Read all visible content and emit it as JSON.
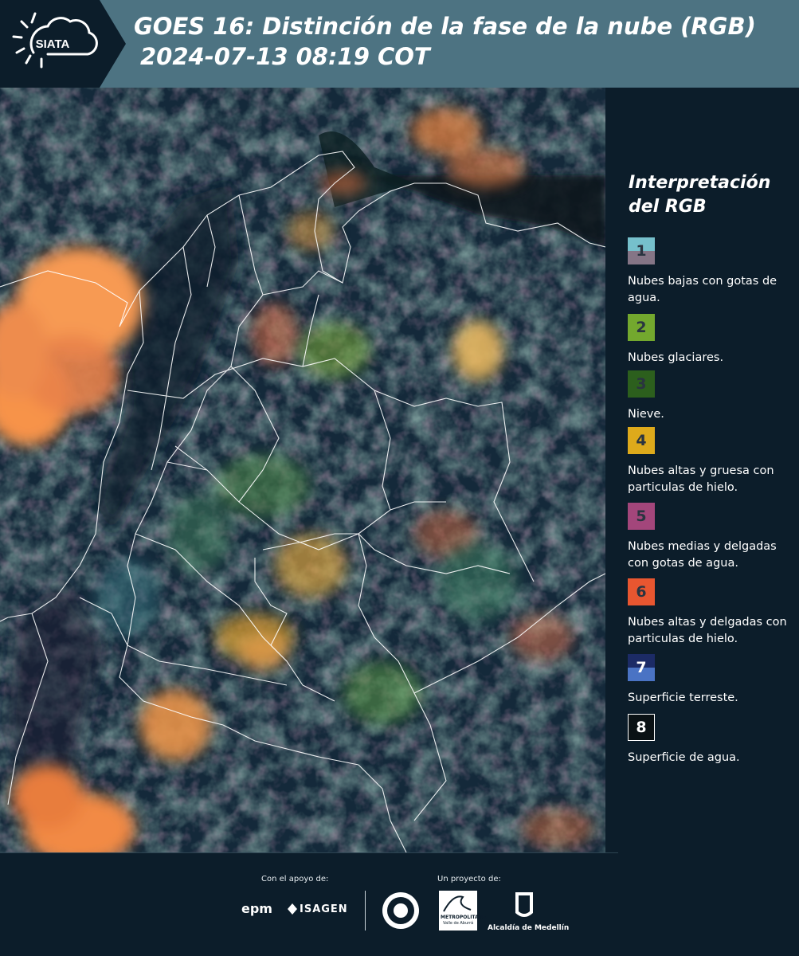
{
  "header": {
    "logo_text": "SIATA",
    "title_line1": "GOES 16: Distinción de la fase de la nube (RGB)",
    "title_line2": "2024-07-13 08:19 COT"
  },
  "legend": {
    "title": "Interpretación del RGB",
    "items": [
      {
        "num": "1",
        "label": "Nubes bajas con gotas de agua.",
        "color_top": "#76c0cc",
        "color_bottom": "#857586"
      },
      {
        "num": "2",
        "label": "Nubes glaciares.",
        "color_top": "#73a82e",
        "color_bottom": "#73a82e"
      },
      {
        "num": "3",
        "label": "Nieve.",
        "color_top": "#2c5f1d",
        "color_bottom": "#2c5f1d"
      },
      {
        "num": "4",
        "label": "Nubes altas y gruesa con particulas de hielo.",
        "color_top": "#deaa1b",
        "color_bottom": "#deaa1b"
      },
      {
        "num": "5",
        "label": "Nubes medias y delgadas con gotas de agua.",
        "color_top": "#a3467b",
        "color_bottom": "#a3467b"
      },
      {
        "num": "6",
        "label": "Nubes altas y delgadas con particulas de hielo.",
        "color_top": "#e85630",
        "color_bottom": "#e85630"
      },
      {
        "num": "7",
        "label": "Superficie terreste.",
        "color_top": "#1c2b66",
        "color_bottom": "#4a73c4"
      },
      {
        "num": "8",
        "label": "Superficie de agua.",
        "color_top": "#0a1114",
        "color_bottom": "#0a1114"
      }
    ]
  },
  "footer": {
    "support_label": "Con el apoyo de:",
    "project_label": "Un proyecto de:",
    "sponsor1": "epm",
    "sponsor2": "ISAGEN",
    "partner1": "METROPOLITANA",
    "partner1_sub": "Valle de Aburrá",
    "partner2": "Alcaldía de Medellín"
  },
  "colors": {
    "header_bg": "#4d7382",
    "logo_bg": "#0c1d2a",
    "page_bg": "#0c1d2a"
  }
}
